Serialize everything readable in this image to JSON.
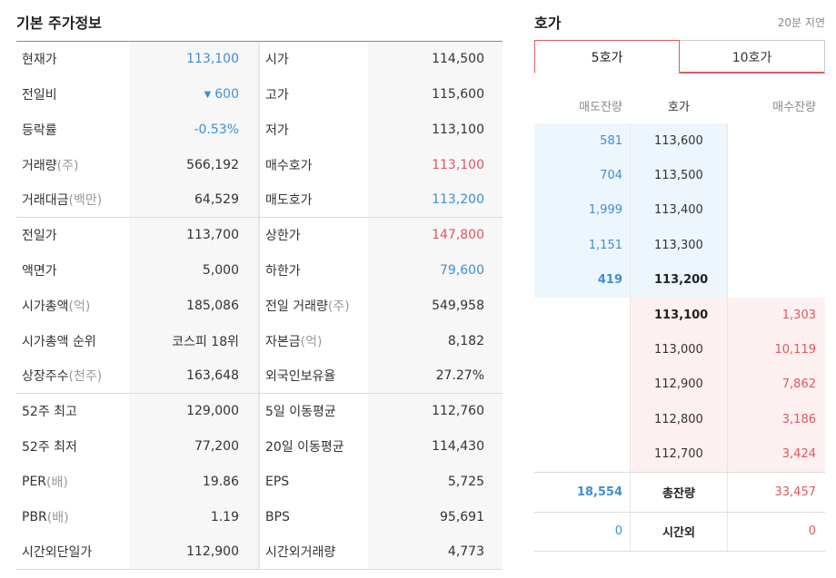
{
  "basic": {
    "title": "기본 주가정보",
    "rows": [
      {
        "l1": "현재가",
        "u1": "",
        "v1": "113,100",
        "c1": "blue",
        "l2": "시가",
        "u2": "",
        "v2": "114,500",
        "c2": ""
      },
      {
        "l1": "전일비",
        "u1": "",
        "v1": "600",
        "tri": "▼",
        "c1": "blue",
        "l2": "고가",
        "u2": "",
        "v2": "115,600",
        "c2": ""
      },
      {
        "l1": "등락률",
        "u1": "",
        "v1": "-0.53%",
        "c1": "blue",
        "l2": "저가",
        "u2": "",
        "v2": "113,100",
        "c2": ""
      },
      {
        "l1": "거래량",
        "u1": "(주)",
        "v1": "566,192",
        "c1": "",
        "l2": "매수호가",
        "u2": "",
        "v2": "113,100",
        "c2": "red"
      },
      {
        "l1": "거래대금",
        "u1": "(백만)",
        "v1": "64,529",
        "c1": "",
        "l2": "매도호가",
        "u2": "",
        "v2": "113,200",
        "c2": "blue"
      },
      {
        "l1": "전일가",
        "u1": "",
        "v1": "113,700",
        "c1": "",
        "l2": "상한가",
        "u2": "",
        "v2": "147,800",
        "c2": "red"
      },
      {
        "l1": "액면가",
        "u1": "",
        "v1": "5,000",
        "c1": "",
        "l2": "하한가",
        "u2": "",
        "v2": "79,600",
        "c2": "blue"
      },
      {
        "l1": "시가총액",
        "u1": "(억)",
        "v1": "185,086",
        "c1": "",
        "l2": "전일 거래량",
        "u2": "(주)",
        "v2": "549,958",
        "c2": ""
      },
      {
        "l1": "시가총액 순위",
        "u1": "",
        "v1": "코스피 18위",
        "c1": "",
        "l2": "자본금",
        "u2": "(억)",
        "v2": "8,182",
        "c2": ""
      },
      {
        "l1": "상장주수",
        "u1": "(천주)",
        "v1": "163,648",
        "c1": "",
        "l2": "외국인보유율",
        "u2": "",
        "v2": "27.27%",
        "c2": ""
      },
      {
        "l1": "52주 최고",
        "u1": "",
        "v1": "129,000",
        "c1": "",
        "l2": "5일 이동평균",
        "u2": "",
        "v2": "112,760",
        "c2": ""
      },
      {
        "l1": "52주 최저",
        "u1": "",
        "v1": "77,200",
        "c1": "",
        "l2": "20일 이동평균",
        "u2": "",
        "v2": "114,430",
        "c2": ""
      },
      {
        "l1": "PER",
        "u1": "(배)",
        "v1": "19.86",
        "c1": "",
        "l2": "EPS",
        "u2": "",
        "v2": "5,725",
        "c2": ""
      },
      {
        "l1": "PBR",
        "u1": "(배)",
        "v1": "1.19",
        "c1": "",
        "l2": "BPS",
        "u2": "",
        "v2": "95,691",
        "c2": ""
      },
      {
        "l1": "시간외단일가",
        "u1": "",
        "v1": "112,900",
        "c1": "",
        "l2": "시간외거래량",
        "u2": "",
        "v2": "4,773",
        "c2": ""
      }
    ]
  },
  "orderbook": {
    "title": "호가",
    "delay": "20분 지연",
    "tabs": [
      "5호가",
      "10호가"
    ],
    "headers": {
      "ask": "매도잔량",
      "price": "호가",
      "bid": "매수잔량"
    },
    "asks": [
      {
        "qty": "581",
        "price": "113,600"
      },
      {
        "qty": "704",
        "price": "113,500"
      },
      {
        "qty": "1,999",
        "price": "113,400"
      },
      {
        "qty": "1,151",
        "price": "113,300"
      },
      {
        "qty": "419",
        "price": "113,200"
      }
    ],
    "bids": [
      {
        "price": "113,100",
        "qty": "1,303"
      },
      {
        "price": "113,000",
        "qty": "10,119"
      },
      {
        "price": "112,900",
        "qty": "7,862"
      },
      {
        "price": "112,800",
        "qty": "3,186"
      },
      {
        "price": "112,700",
        "qty": "3,424"
      }
    ],
    "total": {
      "label": "총잔량",
      "ask": "18,554",
      "bid": "33,457"
    },
    "afterhours": {
      "label": "시간외",
      "ask": "0",
      "bid": "0"
    }
  },
  "colors": {
    "up": "#e0585e",
    "down": "#3d8fd5"
  }
}
